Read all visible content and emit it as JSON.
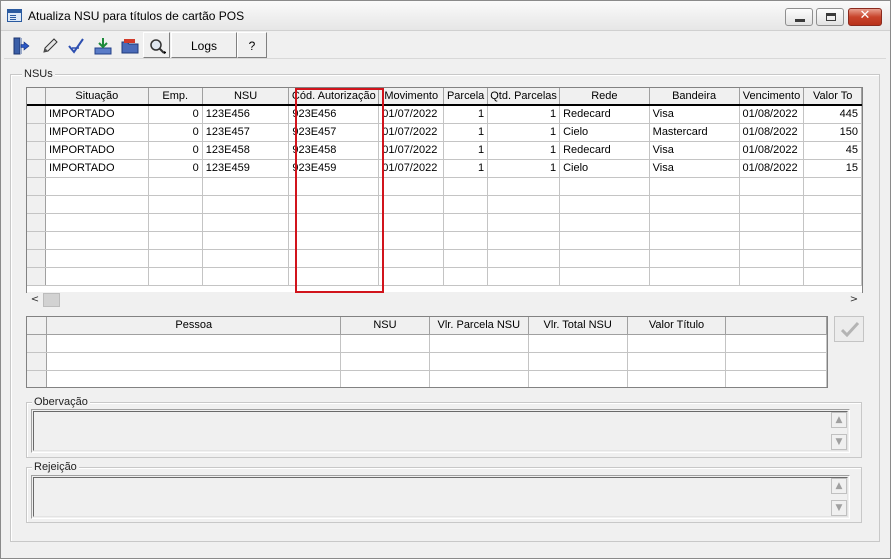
{
  "window": {
    "title": "Atualiza NSU para títulos de cartão POS"
  },
  "toolbar": {
    "buttons": [
      {
        "name": "exit-button",
        "icon": "exit-door-icon"
      },
      {
        "name": "edit-button",
        "icon": "pencil-icon"
      },
      {
        "name": "check-button",
        "icon": "check-arrow-icon"
      },
      {
        "name": "import-button",
        "icon": "download-tray-icon"
      },
      {
        "name": "folder-button",
        "icon": "folder-red-icon"
      },
      {
        "name": "search-button",
        "icon": "magnifier-icon"
      }
    ],
    "logs_label": "Logs",
    "help_label": "?"
  },
  "nsus": {
    "group_label": "NSUs",
    "columns": [
      "Situação",
      "Emp.",
      "NSU",
      "Cód. Autorização",
      "Movimento",
      "Parcela",
      "Qtd. Parcelas",
      "Rede",
      "Bandeira",
      "Vencimento",
      "Valor To"
    ],
    "rows": [
      [
        "IMPORTADO",
        "0",
        "123E456",
        "923E456",
        "01/07/2022",
        "1",
        "1",
        "Redecard",
        "Visa",
        "01/08/2022",
        "445"
      ],
      [
        "IMPORTADO",
        "0",
        "123E457",
        "923E457",
        "01/07/2022",
        "1",
        "1",
        "Cielo",
        "Mastercard",
        "01/08/2022",
        "150"
      ],
      [
        "IMPORTADO",
        "0",
        "123E458",
        "923E458",
        "01/07/2022",
        "1",
        "1",
        "Redecard",
        "Visa",
        "01/08/2022",
        "45"
      ],
      [
        "IMPORTADO",
        "0",
        "123E459",
        "923E459",
        "01/07/2022",
        "1",
        "1",
        "Cielo",
        "Visa",
        "01/08/2022",
        "15"
      ]
    ],
    "scroll_left": "<",
    "scroll_right": ">"
  },
  "titles": {
    "columns": [
      "Pessoa",
      "NSU",
      "Vlr. Parcela NSU",
      "Vlr. Total NSU",
      "Valor Título",
      ""
    ]
  },
  "observacao": {
    "label": "Obervação"
  },
  "rejeicao": {
    "label": "Rejeição"
  },
  "colors": {
    "highlight": "#d1141c",
    "close_button": "#c8432b"
  }
}
